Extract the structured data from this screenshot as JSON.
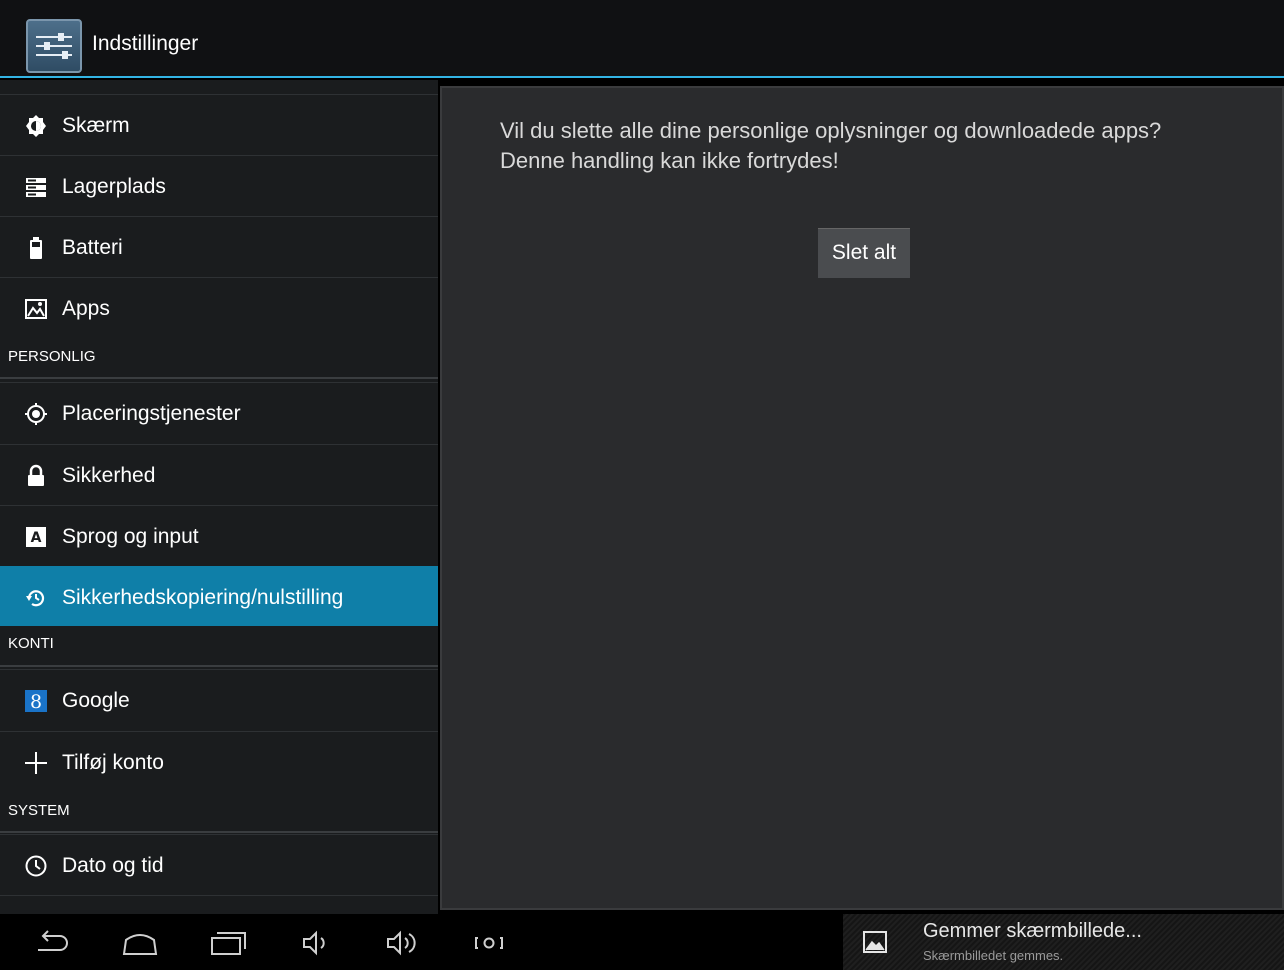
{
  "action_bar": {
    "title": "Indstillinger"
  },
  "sidebar": {
    "items": [
      {
        "label": "Skærm",
        "icon": "brightness-icon"
      },
      {
        "label": "Lagerplads",
        "icon": "storage-icon"
      },
      {
        "label": "Batteri",
        "icon": "battery-icon"
      },
      {
        "label": "Apps",
        "icon": "apps-icon"
      }
    ],
    "personal_header": "PERSONLIG",
    "personal_items": [
      {
        "label": "Placeringstjenester",
        "icon": "location-icon"
      },
      {
        "label": "Sikkerhed",
        "icon": "lock-icon"
      },
      {
        "label": "Sprog og input",
        "icon": "keyboard-icon"
      },
      {
        "label": "Sikkerhedskopiering/nulstilling",
        "icon": "backup-icon",
        "selected": true
      }
    ],
    "accounts_header": "KONTI",
    "accounts_items": [
      {
        "label": "Google",
        "icon": "google-icon"
      },
      {
        "label": "Tilføj konto",
        "icon": "plus-icon"
      }
    ],
    "system_header": "SYSTEM",
    "system_items": [
      {
        "label": "Dato og tid",
        "icon": "clock-icon"
      }
    ]
  },
  "main": {
    "message": "Vil du slette alle dine personlige oplysninger og downloadede apps? Denne handling kan ikke fortrydes!",
    "button_label": "Slet alt"
  },
  "notification": {
    "title": "Gemmer skærmbillede...",
    "subtitle": "Skærmbilledet gemmes."
  },
  "colors": {
    "accent": "#33b5e5",
    "selected": "#0f7fa8",
    "panel": "#2a2b2d",
    "list_bg": "#1a1c1e"
  }
}
